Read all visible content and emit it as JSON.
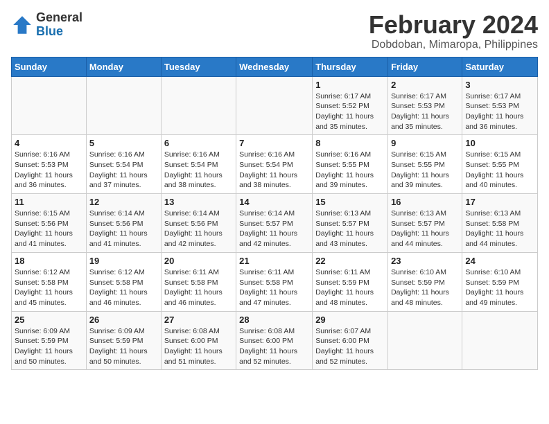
{
  "header": {
    "logo_line1": "General",
    "logo_line2": "Blue",
    "month_year": "February 2024",
    "location": "Dobdoban, Mimaropa, Philippines"
  },
  "weekdays": [
    "Sunday",
    "Monday",
    "Tuesday",
    "Wednesday",
    "Thursday",
    "Friday",
    "Saturday"
  ],
  "weeks": [
    [
      {
        "day": "",
        "info": ""
      },
      {
        "day": "",
        "info": ""
      },
      {
        "day": "",
        "info": ""
      },
      {
        "day": "",
        "info": ""
      },
      {
        "day": "1",
        "info": "Sunrise: 6:17 AM\nSunset: 5:52 PM\nDaylight: 11 hours\nand 35 minutes."
      },
      {
        "day": "2",
        "info": "Sunrise: 6:17 AM\nSunset: 5:53 PM\nDaylight: 11 hours\nand 35 minutes."
      },
      {
        "day": "3",
        "info": "Sunrise: 6:17 AM\nSunset: 5:53 PM\nDaylight: 11 hours\nand 36 minutes."
      }
    ],
    [
      {
        "day": "4",
        "info": "Sunrise: 6:16 AM\nSunset: 5:53 PM\nDaylight: 11 hours\nand 36 minutes."
      },
      {
        "day": "5",
        "info": "Sunrise: 6:16 AM\nSunset: 5:54 PM\nDaylight: 11 hours\nand 37 minutes."
      },
      {
        "day": "6",
        "info": "Sunrise: 6:16 AM\nSunset: 5:54 PM\nDaylight: 11 hours\nand 38 minutes."
      },
      {
        "day": "7",
        "info": "Sunrise: 6:16 AM\nSunset: 5:54 PM\nDaylight: 11 hours\nand 38 minutes."
      },
      {
        "day": "8",
        "info": "Sunrise: 6:16 AM\nSunset: 5:55 PM\nDaylight: 11 hours\nand 39 minutes."
      },
      {
        "day": "9",
        "info": "Sunrise: 6:15 AM\nSunset: 5:55 PM\nDaylight: 11 hours\nand 39 minutes."
      },
      {
        "day": "10",
        "info": "Sunrise: 6:15 AM\nSunset: 5:55 PM\nDaylight: 11 hours\nand 40 minutes."
      }
    ],
    [
      {
        "day": "11",
        "info": "Sunrise: 6:15 AM\nSunset: 5:56 PM\nDaylight: 11 hours\nand 41 minutes."
      },
      {
        "day": "12",
        "info": "Sunrise: 6:14 AM\nSunset: 5:56 PM\nDaylight: 11 hours\nand 41 minutes."
      },
      {
        "day": "13",
        "info": "Sunrise: 6:14 AM\nSunset: 5:56 PM\nDaylight: 11 hours\nand 42 minutes."
      },
      {
        "day": "14",
        "info": "Sunrise: 6:14 AM\nSunset: 5:57 PM\nDaylight: 11 hours\nand 42 minutes."
      },
      {
        "day": "15",
        "info": "Sunrise: 6:13 AM\nSunset: 5:57 PM\nDaylight: 11 hours\nand 43 minutes."
      },
      {
        "day": "16",
        "info": "Sunrise: 6:13 AM\nSunset: 5:57 PM\nDaylight: 11 hours\nand 44 minutes."
      },
      {
        "day": "17",
        "info": "Sunrise: 6:13 AM\nSunset: 5:58 PM\nDaylight: 11 hours\nand 44 minutes."
      }
    ],
    [
      {
        "day": "18",
        "info": "Sunrise: 6:12 AM\nSunset: 5:58 PM\nDaylight: 11 hours\nand 45 minutes."
      },
      {
        "day": "19",
        "info": "Sunrise: 6:12 AM\nSunset: 5:58 PM\nDaylight: 11 hours\nand 46 minutes."
      },
      {
        "day": "20",
        "info": "Sunrise: 6:11 AM\nSunset: 5:58 PM\nDaylight: 11 hours\nand 46 minutes."
      },
      {
        "day": "21",
        "info": "Sunrise: 6:11 AM\nSunset: 5:58 PM\nDaylight: 11 hours\nand 47 minutes."
      },
      {
        "day": "22",
        "info": "Sunrise: 6:11 AM\nSunset: 5:59 PM\nDaylight: 11 hours\nand 48 minutes."
      },
      {
        "day": "23",
        "info": "Sunrise: 6:10 AM\nSunset: 5:59 PM\nDaylight: 11 hours\nand 48 minutes."
      },
      {
        "day": "24",
        "info": "Sunrise: 6:10 AM\nSunset: 5:59 PM\nDaylight: 11 hours\nand 49 minutes."
      }
    ],
    [
      {
        "day": "25",
        "info": "Sunrise: 6:09 AM\nSunset: 5:59 PM\nDaylight: 11 hours\nand 50 minutes."
      },
      {
        "day": "26",
        "info": "Sunrise: 6:09 AM\nSunset: 5:59 PM\nDaylight: 11 hours\nand 50 minutes."
      },
      {
        "day": "27",
        "info": "Sunrise: 6:08 AM\nSunset: 6:00 PM\nDaylight: 11 hours\nand 51 minutes."
      },
      {
        "day": "28",
        "info": "Sunrise: 6:08 AM\nSunset: 6:00 PM\nDaylight: 11 hours\nand 52 minutes."
      },
      {
        "day": "29",
        "info": "Sunrise: 6:07 AM\nSunset: 6:00 PM\nDaylight: 11 hours\nand 52 minutes."
      },
      {
        "day": "",
        "info": ""
      },
      {
        "day": "",
        "info": ""
      }
    ]
  ]
}
